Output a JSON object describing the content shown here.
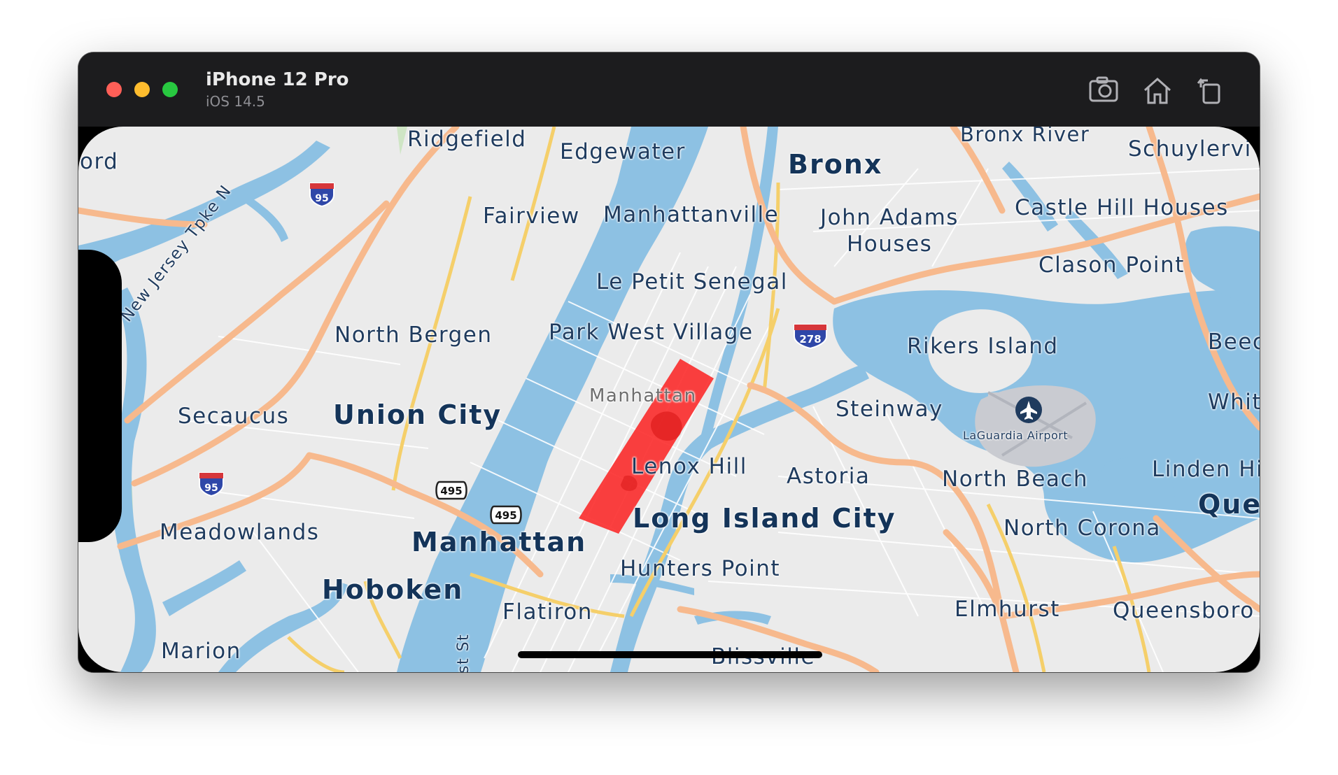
{
  "window": {
    "device_name": "iPhone 12 Pro",
    "os_version": "iOS 14.5",
    "icons": [
      "screenshot-icon",
      "home-icon",
      "rotate-icon"
    ]
  },
  "colors": {
    "water": "#8dc1e3",
    "land": "#ebebeb",
    "highway": "#f7b98d",
    "arterial": "#f5cf6a",
    "polygon": "#fb2b2b",
    "airport": "#c9cbd1",
    "label": "#1f3b5e"
  },
  "map": {
    "labels": {
      "ridgefield": "Ridgefield",
      "edgewater": "Edgewater",
      "bronx_river": "Bronx River",
      "schuylerville": "Schuylervi",
      "rford": "ord",
      "bronx": "Bronx",
      "fairview": "Fairview",
      "manhattanville": "Manhattanville",
      "john_adams_1": "John Adams",
      "john_adams_2": "Houses",
      "castle_hill": "Castle Hill Houses",
      "clason_point": "Clason Point",
      "le_petit_senegal": "Le Petit Senegal",
      "north_bergen": "North Bergen",
      "park_west_village": "Park West Village",
      "rikers_island": "Rikers Island",
      "beech": "Beec",
      "manhattan_small": "Manhattan",
      "white": "Whit",
      "secaucus": "Secaucus",
      "union_city": "Union City",
      "steinway": "Steinway",
      "laguardia": "LaGuardia Airport",
      "linden_hill": "Linden Hi",
      "lenox_hill": "Lenox Hill",
      "astoria": "Astoria",
      "north_beach": "North Beach",
      "queens": "Que",
      "long_island_city": "Long Island City",
      "north_corona": "North Corona",
      "meadowlands": "Meadowlands",
      "manhattan": "Manhattan",
      "hunters_point": "Hunters Point",
      "hoboken": "Hoboken",
      "flatiron": "Flatiron",
      "elmhurst": "Elmhurst",
      "queensboro": "Queensboro",
      "marion": "Marion",
      "blissville": "Blissville",
      "nj_tpke": "New Jersey Tpke N",
      "st": "st St"
    },
    "shields": {
      "i95_north": "95",
      "i95_south": "95",
      "i278": "278",
      "r495_a": "495",
      "r495_b": "495"
    }
  }
}
